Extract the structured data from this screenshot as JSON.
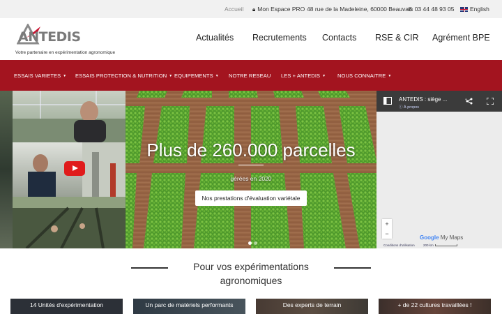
{
  "topbar": {
    "home": "Accueil",
    "espace": "Mon Espace PRO",
    "address": "48 rue de la Madeleine, 60000 Beauvais",
    "phone": "03 44 48 93 05",
    "language": "English"
  },
  "logo": {
    "name": "ANTEDIS",
    "tagline": "Votre partenaire en expérimentation agronomique"
  },
  "main_nav": [
    "Actualités",
    "Recrutements",
    "Contacts",
    "RSE & CIR",
    "Agrément BPE"
  ],
  "red_nav": [
    {
      "label": "ESSAIS VARIETES",
      "dropdown": true
    },
    {
      "label": "ESSAIS PROTECTION & NUTRITION",
      "dropdown": true
    },
    {
      "label": "EQUIPEMENTS",
      "dropdown": true
    },
    {
      "label": "NOTRE RESEAU",
      "dropdown": false
    },
    {
      "label": "LES + ANTEDIS",
      "dropdown": true
    },
    {
      "label": "NOUS CONNAITRE",
      "dropdown": true
    }
  ],
  "hero": {
    "title": "Plus de 260.000 parcelles",
    "subtitle": "gérées en 2020",
    "button": "Nos prestations d'évaluation variétale"
  },
  "map": {
    "title": "ANTEDIS : siège ...",
    "about": "À propos",
    "zoom_in": "+",
    "zoom_out": "−",
    "brand_google": "Google",
    "brand_mymaps": "My Maps",
    "conditions": "Conditions d'utilisation",
    "scale": "200 km"
  },
  "section": {
    "title": "Pour vos expérimentations agronomiques"
  },
  "cards": [
    "14 Unités d'expérimentation",
    "Un parc de matériels performants",
    "Des experts de terrain",
    "+ de 22 cultures travaillées !"
  ],
  "colors": {
    "brand_red": "#a3141f",
    "topbar_bg": "#f1f1f1",
    "youtube_red": "#e01b1b"
  }
}
